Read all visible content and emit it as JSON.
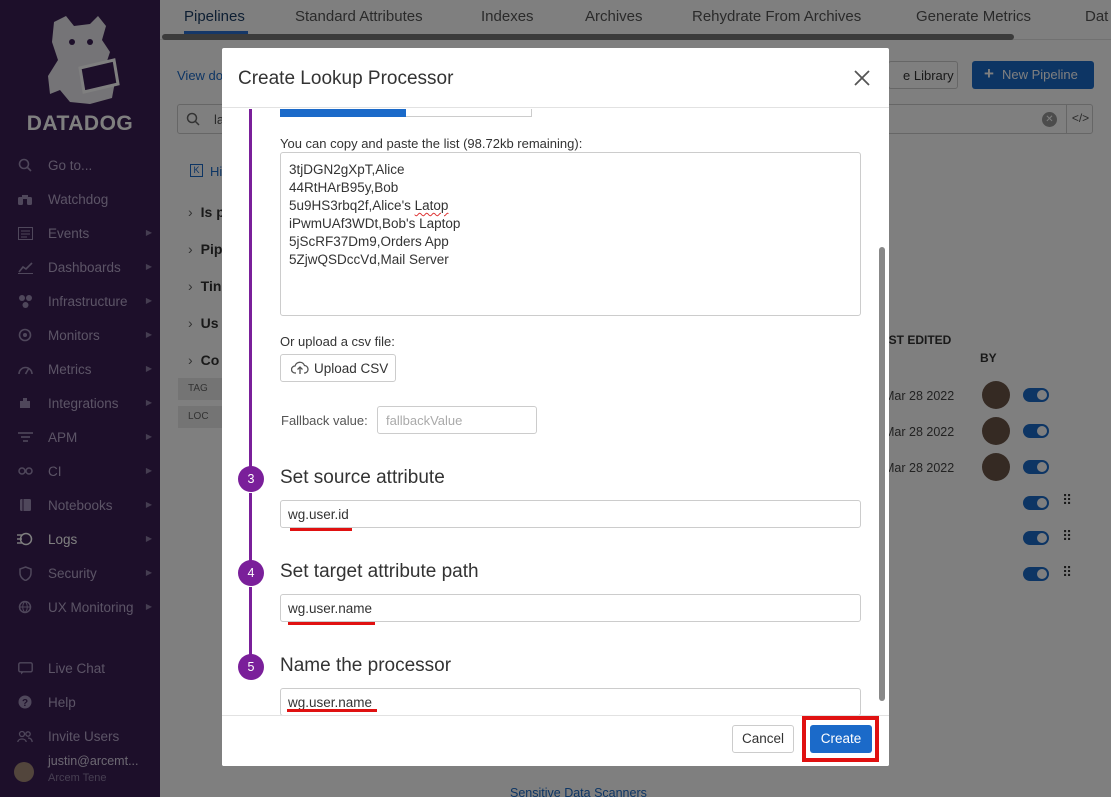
{
  "sidebar": {
    "logo_text": "DATADOG",
    "nav": [
      {
        "label": "Go to...",
        "icon": "search-icon",
        "caret": false
      },
      {
        "label": "Watchdog",
        "icon": "binoculars-icon",
        "caret": false
      },
      {
        "label": "Events",
        "icon": "events-icon",
        "caret": true
      },
      {
        "label": "Dashboards",
        "icon": "dashboards-icon",
        "caret": true
      },
      {
        "label": "Infrastructure",
        "icon": "infrastructure-icon",
        "caret": true
      },
      {
        "label": "Monitors",
        "icon": "monitors-icon",
        "caret": true
      },
      {
        "label": "Metrics",
        "icon": "metrics-icon",
        "caret": true
      },
      {
        "label": "Integrations",
        "icon": "integrations-icon",
        "caret": true
      },
      {
        "label": "APM",
        "icon": "apm-icon",
        "caret": true
      },
      {
        "label": "CI",
        "icon": "ci-icon",
        "caret": true
      },
      {
        "label": "Notebooks",
        "icon": "notebooks-icon",
        "caret": true
      },
      {
        "label": "Logs",
        "icon": "logs-icon",
        "caret": true
      },
      {
        "label": "Security",
        "icon": "security-icon",
        "caret": true
      },
      {
        "label": "UX Monitoring",
        "icon": "ux-icon",
        "caret": true
      }
    ],
    "bottom": [
      {
        "label": "Live Chat",
        "icon": "chat-icon"
      },
      {
        "label": "Help",
        "icon": "help-icon"
      },
      {
        "label": "Invite Users",
        "icon": "users-icon"
      }
    ],
    "user_name": "justin@arcemt...",
    "user_org": "Arcem Tene"
  },
  "tabs": [
    "Pipelines",
    "Standard Attributes",
    "Indexes",
    "Archives",
    "Rehydrate From Archives",
    "Generate Metrics",
    "Dat"
  ],
  "main": {
    "view_docs": "View do",
    "library_btn": "e Library",
    "new_pipeline_btn": "New Pipeline",
    "search_value": "la",
    "hide_text": "Hi",
    "filters": [
      "Is p",
      "Pip",
      "Tin",
      "Us",
      "Co"
    ],
    "tags": [
      "TAG",
      "LOC"
    ],
    "col_last_edited": "AST EDITED",
    "col_by": "BY",
    "dates": [
      "Mar 28 2022",
      "Mar 28 2022",
      "Mar 28 2022"
    ],
    "sensitive_link": "Sensitive Data Scanners"
  },
  "modal": {
    "title": "Create Lookup Processor",
    "copy_label": "You can copy and paste the list (98.72kb remaining):",
    "mapping_lines": [
      "3tjDGN2gXpT,Alice",
      "44RtHArB95y,Bob",
      "5u9HS3rbq2f,Alice's Latop",
      "iPwmUAf3WDt,Bob's Laptop",
      "5jScRF37Dm9,Orders App",
      "5ZjwQSDccVd,Mail Server"
    ],
    "upload_label": "Or upload a csv file:",
    "upload_btn": "Upload CSV",
    "fallback_label": "Fallback value:",
    "fallback_placeholder": "fallbackValue",
    "steps": [
      {
        "num": "3",
        "title": "Set source attribute",
        "value": "wg.user.id"
      },
      {
        "num": "4",
        "title": "Set target attribute path",
        "value": "wg.user.name"
      },
      {
        "num": "5",
        "title": "Name the processor",
        "value": "wg.user.name"
      }
    ],
    "cancel": "Cancel",
    "create": "Create"
  },
  "colors": {
    "sidebar_bg": "#3a1e55",
    "accent": "#1b6ac9",
    "step": "#7a1f9a",
    "highlight": "#e01111"
  }
}
